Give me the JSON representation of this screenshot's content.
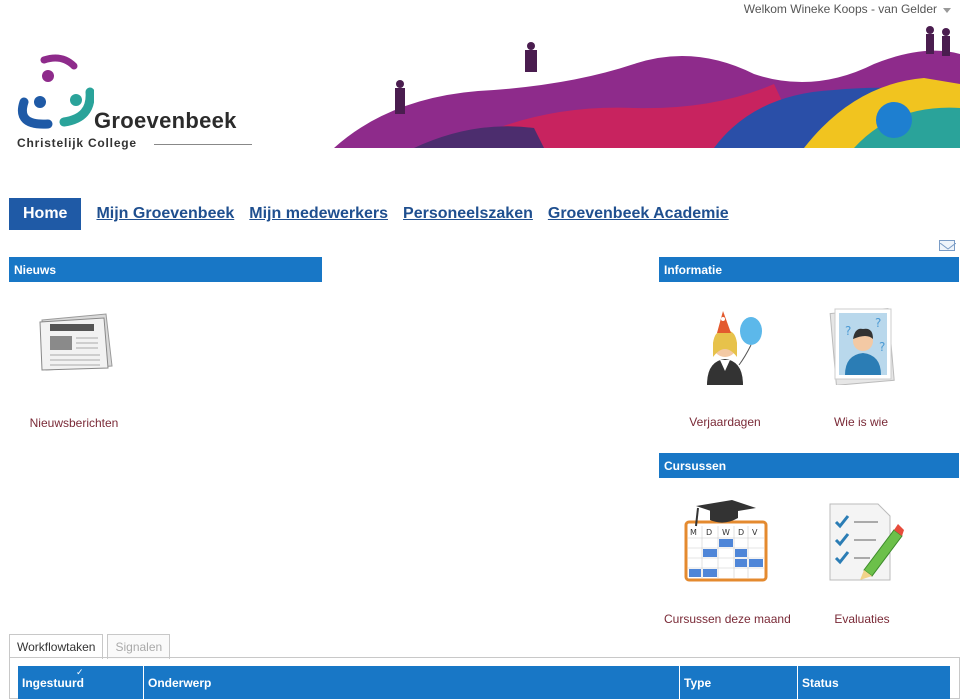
{
  "header": {
    "welcome_text": "Welkom Wineke Koops - van Gelder"
  },
  "logo": {
    "title": "Groevenbeek",
    "subtitle": "Christelijk College"
  },
  "nav": {
    "items": [
      {
        "label": "Home",
        "active": true
      },
      {
        "label": "Mijn Groevenbeek"
      },
      {
        "label": "Mijn medewerkers"
      },
      {
        "label": "Personeelszaken"
      },
      {
        "label": "Groevenbeek Academie"
      }
    ]
  },
  "sections": {
    "nieuws": {
      "title": "Nieuws",
      "tiles": [
        {
          "label": "Nieuwsberichten",
          "icon": "newspaper-icon"
        }
      ]
    },
    "informatie": {
      "title": "Informatie",
      "tiles": [
        {
          "label": "Verjaardagen",
          "icon": "birthday-person-icon"
        },
        {
          "label": "Wie is wie",
          "icon": "who-is-who-icon"
        }
      ]
    },
    "cursussen": {
      "title": "Cursussen",
      "tiles": [
        {
          "label": "Cursussen deze maand",
          "icon": "course-calendar-icon"
        },
        {
          "label": "Evaluaties",
          "icon": "evaluation-checklist-icon"
        }
      ],
      "calendar_days": [
        "M",
        "D",
        "W",
        "D",
        "V"
      ]
    }
  },
  "workflow": {
    "tabs": [
      {
        "label": "Workflowtaken",
        "active": true
      },
      {
        "label": "Signalen",
        "active": false
      }
    ],
    "columns": [
      "Ingestuurd",
      "Onderwerp",
      "Type",
      "Status"
    ]
  },
  "colors": {
    "header_blue": "#1877c6",
    "nav_active": "#1f5aa6",
    "link_blue": "#1f4f8f",
    "tile_label": "#7a2a37"
  }
}
